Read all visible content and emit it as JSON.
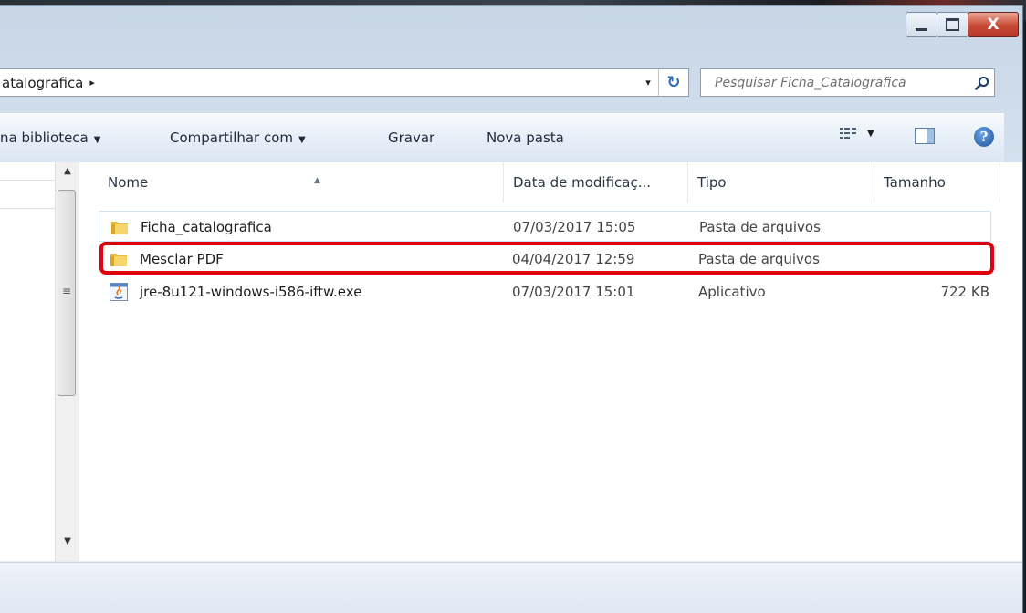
{
  "window": {
    "close_label": "X"
  },
  "address": {
    "crumb": "atalografica",
    "crumb_separator": "▸",
    "dropdown": "▾",
    "refresh_glyph": "↻"
  },
  "search": {
    "placeholder": "Pesquisar Ficha_Catalografica"
  },
  "toolbar": {
    "include_library": "na biblioteca",
    "share_with": "Compartilhar com",
    "burn": "Gravar",
    "new_folder": "Nova pasta",
    "dropdown_caret": "▼",
    "help": "?"
  },
  "columns": {
    "name": "Nome",
    "date": "Data de modificaç...",
    "type": "Tipo",
    "size": "Tamanho"
  },
  "files": [
    {
      "name": "Ficha_catalografica",
      "date": "07/03/2017 15:05",
      "type": "Pasta de arquivos",
      "size": "",
      "icon": "folder-icon"
    },
    {
      "name": "Mesclar PDF",
      "date": "04/04/2017 12:59",
      "type": "Pasta de arquivos",
      "size": "",
      "icon": "folder-icon"
    },
    {
      "name": "jre-8u121-windows-i586-iftw.exe",
      "date": "07/03/2017 15:01",
      "type": "Aplicativo",
      "size": "722 KB",
      "icon": "java-exe-icon"
    }
  ],
  "colors": {
    "highlight": "#e0000b",
    "accent": "#2c6fb6"
  }
}
